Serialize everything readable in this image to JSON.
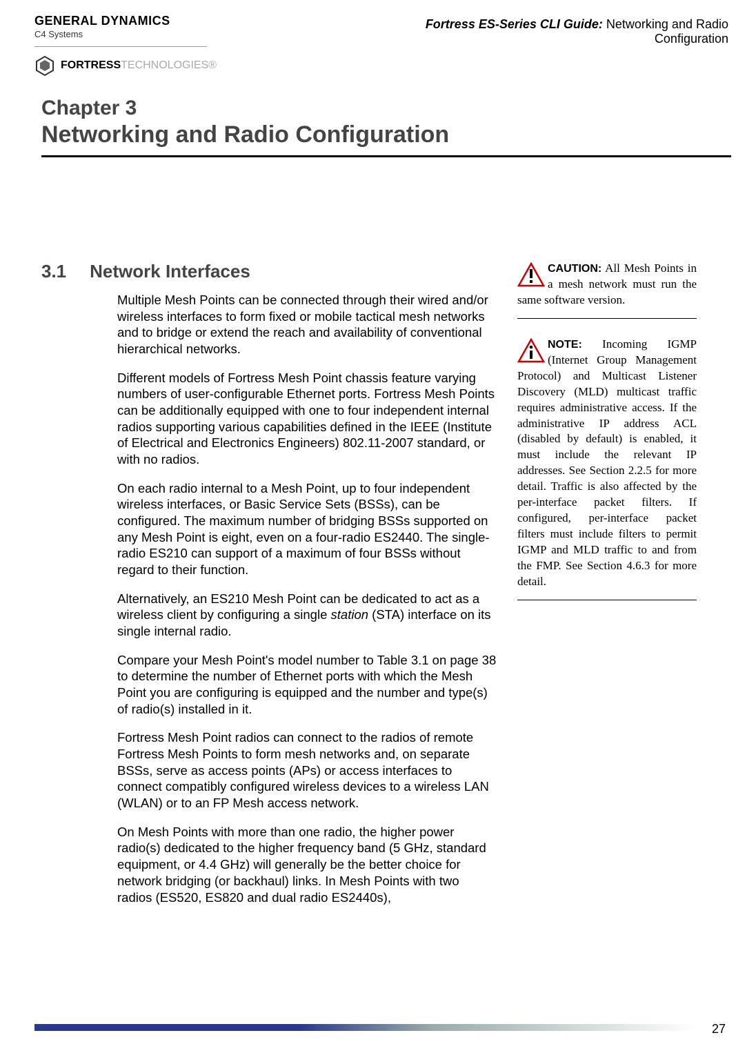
{
  "header": {
    "gd_logo_main": "GENERAL DYNAMICS",
    "gd_logo_sub": "C4 Systems",
    "fortress_logo_bold": "FORTRESS",
    "fortress_logo_light": "TECHNOLOGIES",
    "fortress_logo_reg": "®",
    "guide_bold": "Fortress ES-Series CLI Guide:",
    "guide_rest": " Networking and Radio Configuration"
  },
  "chapter": {
    "label": "Chapter 3",
    "title": "Networking and Radio Configuration"
  },
  "section": {
    "num": "3.1",
    "title": "Network Interfaces"
  },
  "paras": {
    "p1": "Multiple Mesh Points can be connected through their wired and/or wireless interfaces to form fixed or mobile tactical mesh networks and to bridge or extend the reach and availability of conventional hierarchical networks.",
    "p2": "Different models of Fortress Mesh Point chassis feature varying numbers of user-configurable Ethernet ports. Fortress Mesh Points can be additionally equipped with one to four independent internal radios supporting various capabilities defined in the IEEE (Institute of Electrical and Electronics Engineers) 802.11-2007 standard, or with no radios.",
    "p3": "On each radio internal to a Mesh Point, up to four independent wireless interfaces, or Basic Service Sets (BSSs), can be configured. The maximum number of bridging BSSs supported on any Mesh Point is eight, even on a four-radio ES2440. The single-radio ES210 can support of a maximum of four BSSs without regard to their function.",
    "p4a": "Alternatively, an ES210 Mesh Point can be dedicated to act as a wireless client by configuring a single ",
    "p4b": "station",
    "p4c": " (STA) interface on its single internal radio.",
    "p5": "Compare your Mesh Point's model number to Table 3.1 on page 38 to determine the number of Ethernet ports with which the Mesh Point you are configuring is equipped and the number and type(s) of radio(s) installed in it.",
    "p6": "Fortress Mesh Point radios can connect to the radios of remote Fortress Mesh Points to form mesh networks and, on separate BSSs, serve as access points (APs) or access interfaces to connect compatibly configured wireless devices to a wireless LAN (WLAN) or to an FP Mesh access network.",
    "p7": "On Mesh Points with more than one radio, the higher power radio(s) dedicated to the higher frequency band (5 GHz, standard equipment, or 4.4 GHz) will generally be the better choice for network bridging (or backhaul) links. In Mesh Points with two radios (ES520, ES820 and dual radio ES2440s),"
  },
  "callouts": {
    "caution_label": "CAUTION:",
    "caution_text": " All Mesh Points in a mesh network must run the same software version.",
    "note_label": "NOTE:",
    "note_text": " Incoming IGMP (Internet Group Management Protocol) and Multicast Listener Discovery (MLD) multicast traffic requires administrative access. If the administrative IP address ACL (disabled by default) is enabled, it must include the relevant IP addresses. See Section 2.2.5 for more detail. Traffic is also affected by the per-interface packet filters. If configured, per-interface packet filters must include filters to permit IGMP and MLD traffic to and from the FMP. See Section 4.6.3 for more detail."
  },
  "page_number": "27"
}
